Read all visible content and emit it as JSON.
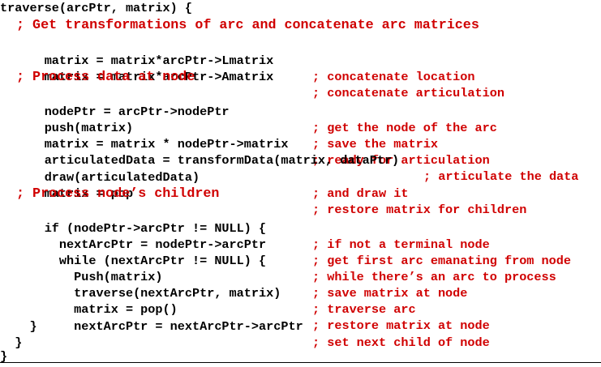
{
  "code": {
    "l01": "traverse(arcPtr, matrix) {",
    "l02": "  ; Get transformations of arc and concatenate arc matrices",
    "l03_code": "  matrix = matrix*arcPtr->Lmatrix",
    "l03_cmt": "; concatenate location",
    "l04_code": "  matrix = matrix*arcPtr->Amatrix",
    "l04_cmt": "; concatenate articulation",
    "l05": "  ; Process data at node",
    "l06_code": "  nodePtr = arcPtr->nodePtr",
    "l06_cmt": "; get the node of the arc",
    "l07_code": "  push(matrix)",
    "l07_cmt": "; save the matrix",
    "l08_code": "  matrix = matrix * nodePtr->matrix",
    "l08_cmt": "; ready for articulation",
    "l09_code": "  articulatedData = transformData(matrix, dataPtr)",
    "l09_cmt": "; articulate the data",
    "l10_code": "  draw(articulatedData)",
    "l10_cmt": "; and draw it",
    "l11_code": "  matrix = pop",
    "l11_cmt": "; restore matrix for children",
    "l12": "  ; Process node’s children",
    "l13_code": "  if (nodePtr->arcPtr != NULL) {",
    "l13_cmt": "; if not a terminal node",
    "l14_code": "    nextArcPtr = nodePtr->arcPtr",
    "l14_cmt": "; get first arc emanating from node",
    "l15_code": "    while (nextArcPtr != NULL) {",
    "l15_cmt": "; while there’s an arc to process",
    "l16_code": "      Push(matrix)",
    "l16_cmt": "; save matrix at node",
    "l17_code": "      traverse(nextArcPtr, matrix)",
    "l17_cmt": "; traverse arc",
    "l18_code": "      matrix = pop()",
    "l18_cmt": "; restore matrix at node",
    "l19_code": "      nextArcPtr = nextArcPtr->arcPtr",
    "l19_cmt": "; set next child of node",
    "l20": "    }",
    "l21": "  }",
    "l22": "}"
  },
  "colors": {
    "code_text": "#000000",
    "comment_text": "#d00000",
    "background": "#ffffff"
  }
}
